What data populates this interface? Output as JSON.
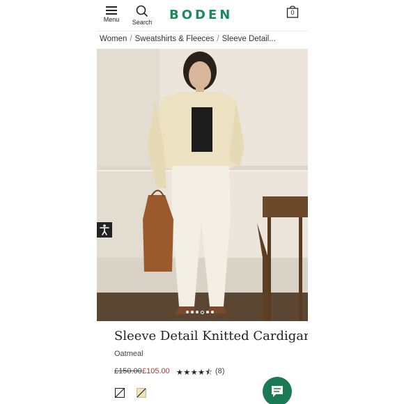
{
  "header": {
    "menu_label": "Menu",
    "search_label": "Search",
    "logo_text": "BODEN",
    "bag_count": "0"
  },
  "breadcrumb": {
    "items": [
      "Women",
      "Sweatshirts & Fleeces",
      "Sleeve Detail..."
    ]
  },
  "gallery": {
    "image_count": 6,
    "active_index": 3
  },
  "product": {
    "title": "Sleeve Detail Knitted Cardigan",
    "color_name": "Oatmeal",
    "price_was": "£150.00",
    "price_now": "£105.00",
    "rating": 4.5,
    "review_count": "(8)"
  },
  "swatches": [
    {
      "name": "black-white swatch"
    },
    {
      "name": "oatmeal swatch"
    }
  ],
  "colors": {
    "brand": "#1a8a5a",
    "sale_price": "#b03a2e",
    "chat_button": "#1a7a55"
  }
}
